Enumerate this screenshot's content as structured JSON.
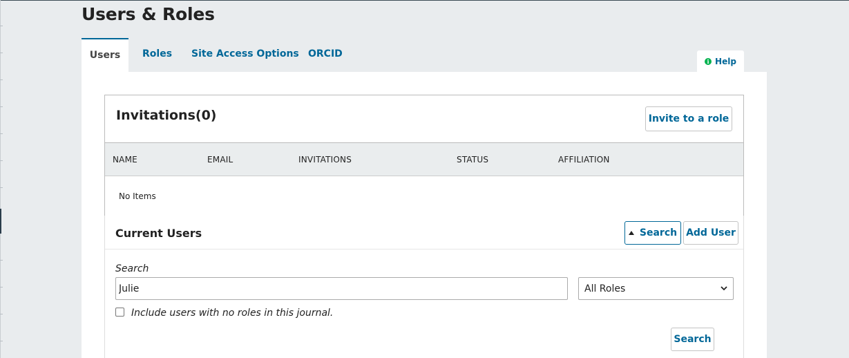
{
  "page": {
    "title": "Users & Roles"
  },
  "tabs": [
    {
      "label": "Users",
      "active": true
    },
    {
      "label": "Roles"
    },
    {
      "label": "Site Access Options"
    },
    {
      "label": "ORCID"
    }
  ],
  "help": {
    "label": "Help",
    "icon": "info-icon"
  },
  "invitations": {
    "title": "Invitations(0)",
    "invite_button": "Invite to a role",
    "columns": [
      "NAME",
      "EMAIL",
      "INVITATIONS",
      "STATUS",
      "AFFILIATION"
    ],
    "empty_text": "No Items"
  },
  "current_users": {
    "title": "Current Users",
    "search_toggle": "Search",
    "add_user": "Add User",
    "search_label": "Search",
    "search_value": "Julie",
    "role_select": "All Roles",
    "include_no_roles_label": "Include users with no roles in this journal.",
    "include_no_roles_checked": false,
    "search_submit": "Search"
  },
  "colors": {
    "link": "#006798",
    "background": "#e9ecee",
    "help_icon": "#00b24e"
  }
}
